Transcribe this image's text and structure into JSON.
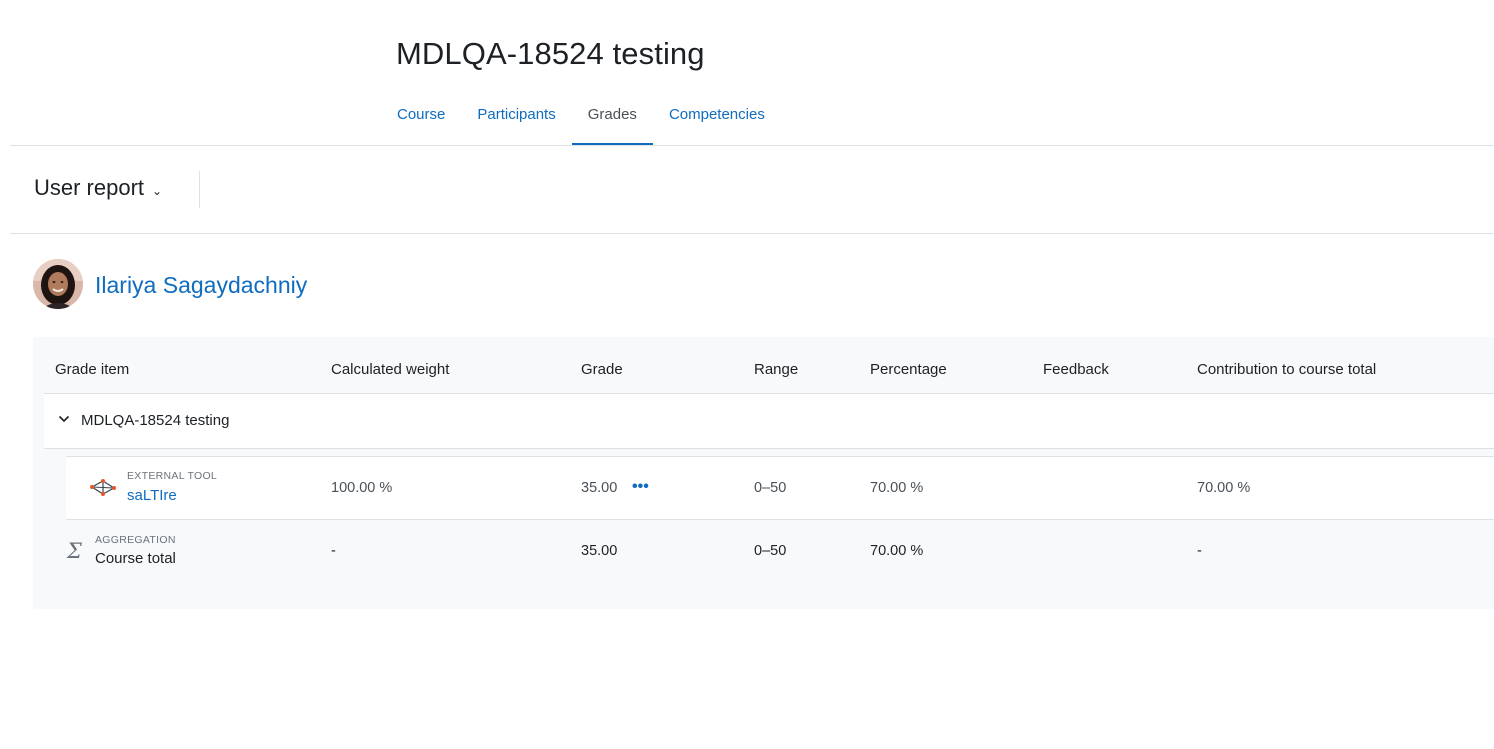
{
  "course": {
    "title": "MDLQA-18524 testing"
  },
  "tabs": [
    {
      "label": "Course",
      "active": false
    },
    {
      "label": "Participants",
      "active": false
    },
    {
      "label": "Grades",
      "active": true
    },
    {
      "label": "Competencies",
      "active": false
    }
  ],
  "report_selector": {
    "label": "User report"
  },
  "user": {
    "name": "Ilariya Sagaydachniy"
  },
  "table": {
    "headers": [
      "Grade item",
      "Calculated weight",
      "Grade",
      "Range",
      "Percentage",
      "Feedback",
      "Contribution to course total"
    ],
    "category": {
      "name": "MDLQA-18524 testing"
    },
    "item": {
      "type": "EXTERNAL TOOL",
      "name": "saLTIre",
      "weight": "100.00 %",
      "grade": "35.00",
      "range": "0–50",
      "percentage": "70.00 %",
      "feedback": "",
      "contribution": "70.00 %"
    },
    "total": {
      "type": "AGGREGATION",
      "name": "Course total",
      "weight": "-",
      "grade": "35.00",
      "range": "0–50",
      "percentage": "70.00 %",
      "feedback": "",
      "contribution": "-"
    }
  },
  "colors": {
    "link": "#0f6cbf",
    "panel": "#f8f9fa",
    "border": "#dee2e6"
  }
}
